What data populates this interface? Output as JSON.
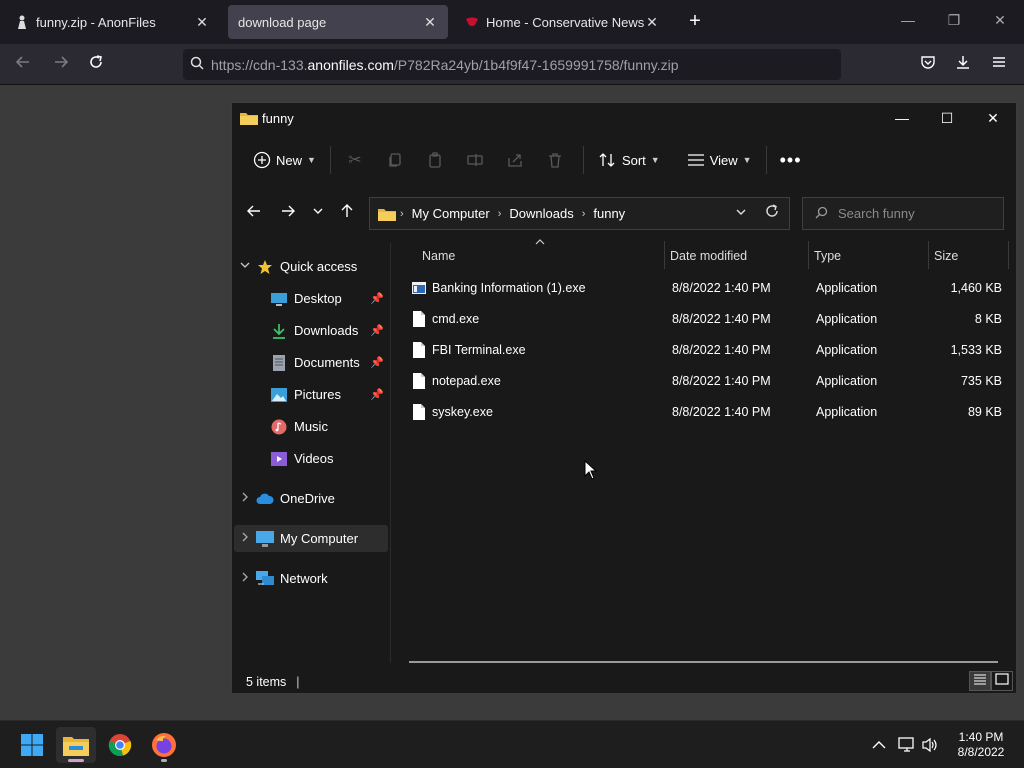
{
  "browser": {
    "tabs": [
      {
        "label": "funny.zip - AnonFiles",
        "active": false
      },
      {
        "label": "download page",
        "active": true
      },
      {
        "label": "Home - Conservative News and",
        "active": false
      }
    ],
    "url": {
      "prefix": "https://cdn-133.",
      "domain": "anonfiles.com",
      "path": "/P782Ra24yb/1b4f9f47-1659991758/funny.zip"
    }
  },
  "explorer": {
    "title": "funny",
    "toolbar": {
      "new_label": "New",
      "sort_label": "Sort",
      "view_label": "View"
    },
    "breadcrumb": [
      "My Computer",
      "Downloads",
      "funny"
    ],
    "search_placeholder": "Search funny",
    "nav": {
      "quick_access": "Quick access",
      "desktop": "Desktop",
      "downloads": "Downloads",
      "documents": "Documents",
      "pictures": "Pictures",
      "music": "Music",
      "videos": "Videos",
      "onedrive": "OneDrive",
      "my_computer": "My Computer",
      "network": "Network"
    },
    "columns": {
      "name": "Name",
      "date": "Date modified",
      "type": "Type",
      "size": "Size"
    },
    "files": [
      {
        "name": "Banking Information (1).exe",
        "date": "8/8/2022 1:40 PM",
        "type": "Application",
        "size": "1,460 KB"
      },
      {
        "name": "cmd.exe",
        "date": "8/8/2022 1:40 PM",
        "type": "Application",
        "size": "8 KB"
      },
      {
        "name": "FBI Terminal.exe",
        "date": "8/8/2022 1:40 PM",
        "type": "Application",
        "size": "1,533 KB"
      },
      {
        "name": "notepad.exe",
        "date": "8/8/2022 1:40 PM",
        "type": "Application",
        "size": "735 KB"
      },
      {
        "name": "syskey.exe",
        "date": "8/8/2022 1:40 PM",
        "type": "Application",
        "size": "89 KB"
      }
    ],
    "status": "5 items"
  },
  "taskbar": {
    "time": "1:40 PM",
    "date": "8/8/2022"
  }
}
